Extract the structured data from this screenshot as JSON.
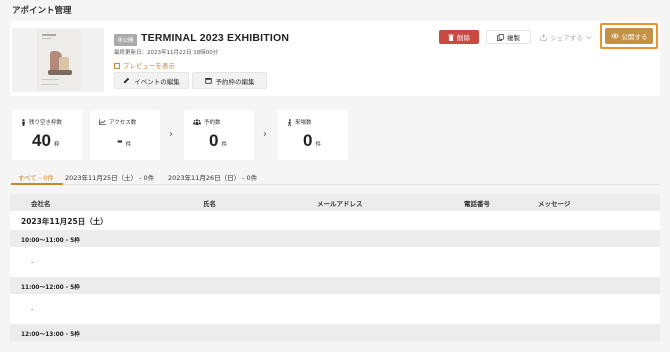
{
  "page": {
    "title": "アポイント管理"
  },
  "event": {
    "status_badge": "非公開",
    "title": "TERMINAL 2023 EXHIBITION",
    "updated": "最終更新日：2023年11月22日 18時00分",
    "preview_label": "プレビューを表示",
    "edit_event_label": "イベントの編集",
    "edit_slots_label": "予約枠の編集"
  },
  "actions": {
    "delete_label": "削除",
    "copy_label": "複製",
    "share_label": "シェアする",
    "publish_label": "公開する",
    "delete_color": "#c94a43",
    "publish_color": "#c49147",
    "highlight_color": "#e8952a"
  },
  "stats": [
    {
      "label": "残り空き枠数",
      "value": "40",
      "unit": "枠",
      "icon": "person-icon"
    },
    {
      "label": "アクセス数",
      "value": "-",
      "unit": "件",
      "icon": "chart-icon"
    },
    {
      "label": "予約数",
      "value": "0",
      "unit": "件",
      "icon": "group-icon"
    },
    {
      "label": "来場数",
      "value": "0",
      "unit": "件",
      "icon": "walking-icon"
    }
  ],
  "tabs": [
    {
      "label": "すべて - 0件",
      "active": true
    },
    {
      "label": "2023年11月25日（土） - 0件",
      "active": false
    },
    {
      "label": "2023年11月26日（日） - 0件",
      "active": false
    }
  ],
  "table": {
    "columns": [
      "会社名",
      "氏名",
      "メールアドレス",
      "電話番号",
      "メッセージ"
    ],
    "date_group": "2023年11月25日（土）",
    "slots": [
      {
        "label": "10:00〜11:00 - 5枠",
        "empty": "-"
      },
      {
        "label": "11:00〜12:00 - 5枠",
        "empty": "-"
      },
      {
        "label": "12:00〜13:00 - 5枠",
        "empty": ""
      }
    ]
  }
}
